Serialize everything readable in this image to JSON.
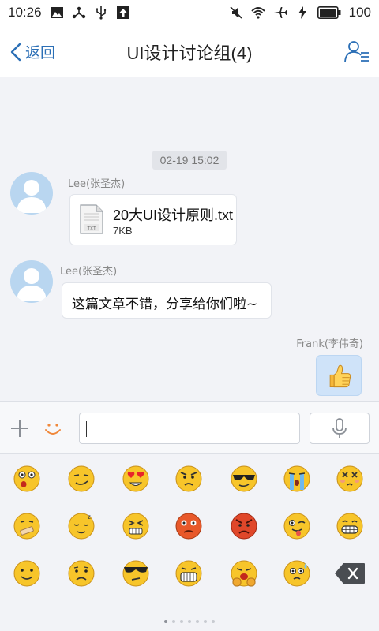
{
  "status_bar": {
    "time": "10:26",
    "battery": "100"
  },
  "nav": {
    "back_label": "返回",
    "title": "UI设计讨论组(4)"
  },
  "chat": {
    "timestamp": "02-19 15:02",
    "messages": [
      {
        "sender": "Lee(张圣杰)",
        "type": "file",
        "file_name": "20大UI设计原则.txt",
        "file_size": "7KB",
        "file_ext": "TXT"
      },
      {
        "sender": "Lee(张圣杰)",
        "type": "text",
        "text": "这篇文章不错，分享给你们啦~"
      },
      {
        "sender": "Frank(李伟奇)",
        "type": "emoji",
        "emoji": "thumbs-up"
      }
    ]
  },
  "input": {
    "value": ""
  },
  "emoji_panel": {
    "rows": [
      [
        "surprised",
        "cool-grin",
        "heart-eyes",
        "angry-brows",
        "sunglasses",
        "crying",
        "dizzy"
      ],
      [
        "shush",
        "sleepy",
        "grimace",
        "red-face",
        "furious",
        "tongue-wink",
        "big-grin"
      ],
      [
        "smile",
        "sad",
        "thug",
        "toothy",
        "sob-hands",
        "sweat"
      ]
    ],
    "page_count": 7,
    "active_page": 0
  },
  "colors": {
    "accent": "#2b6fb6",
    "my_bubble": "#cfe3f9",
    "background": "#f2f3f7",
    "emoji_yellow": "#f7c52a"
  }
}
